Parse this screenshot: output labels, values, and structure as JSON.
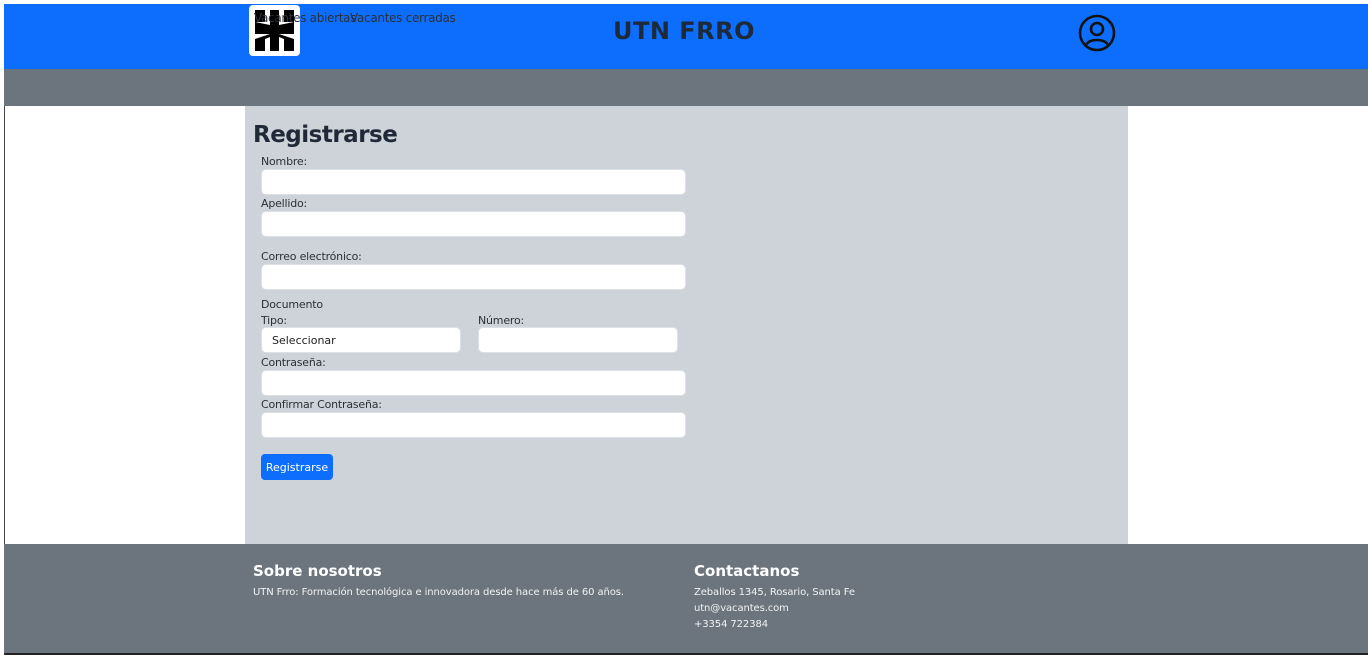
{
  "header": {
    "title": "UTN FRRO",
    "logo_icon": "utn-logo-icon",
    "user_icon": "user-circle-icon",
    "bg_color": "#0d6efd"
  },
  "nav": {
    "items": [
      {
        "label": "Vacantes abiertas"
      },
      {
        "label": "Vacantes cerradas"
      }
    ]
  },
  "form": {
    "title": "Registrarse",
    "nombre_label": "Nombre:",
    "nombre_value": "",
    "apellido_label": "Apellido:",
    "apellido_value": "",
    "correo_label": "Correo electrónico:",
    "correo_value": "",
    "documento_label": "Documento",
    "tipo_label": "Tipo:",
    "tipo_selected": "Seleccionar",
    "numero_label": "Número:",
    "numero_value": "",
    "password_label": "Contraseña:",
    "password_value": "",
    "confirm_label": "Confirmar Contraseña:",
    "confirm_value": "",
    "submit_label": "Registrarse"
  },
  "footer": {
    "about_title": "Sobre nosotros",
    "about_text": "UTN Frro: Formación tecnológica e innovadora desde hace más de 60 años.",
    "contact_title": "Contactanos",
    "address": "Zeballos 1345, Rosario, Santa Fe",
    "email": "utn@vacantes.com",
    "phone": "+3354 722384"
  }
}
